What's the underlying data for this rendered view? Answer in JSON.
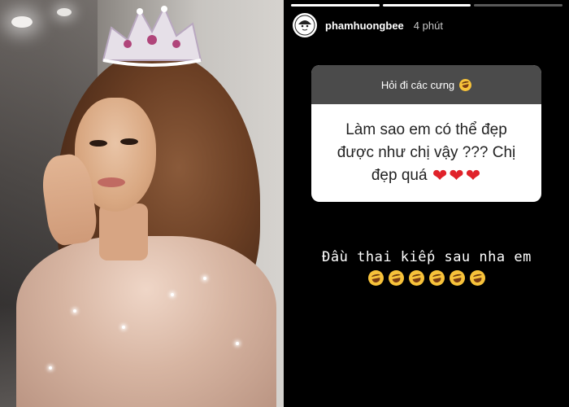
{
  "story": {
    "username": "phamhuongbee",
    "time": "4 phút",
    "question_header": "Hỏi đi các cưng",
    "question_text": "Làm sao em có thể đẹp được như chị vậy ??? Chị đẹp quá",
    "question_hearts": [
      "heart",
      "heart",
      "heart"
    ],
    "answer_text": "Đầu thai kiếp sau nha em",
    "answer_emojis": [
      "rofl",
      "rofl",
      "rofl",
      "rofl",
      "rofl",
      "rofl"
    ]
  },
  "colors": {
    "story_background": "#000000",
    "card_header": "#4b4b4b",
    "card_body": "#ffffff",
    "heart": "#e0222a",
    "emoji": "#f7c23a"
  }
}
